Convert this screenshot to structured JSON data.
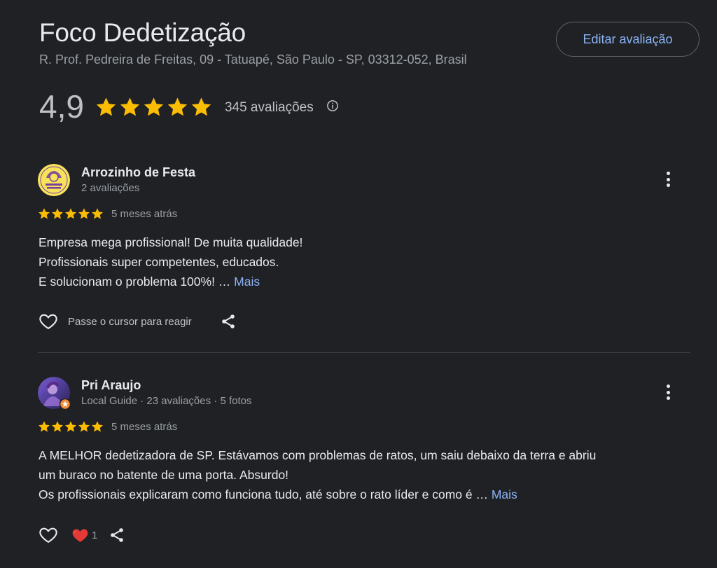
{
  "business": {
    "name": "Foco Dedetização",
    "address": "R. Prof. Pedreira de Freitas, 09 - Tatuapé, São Paulo - SP, 03312-052, Brasil",
    "edit_review_label": "Editar avaliação",
    "rating": "4,9",
    "stars": 5,
    "review_count_label": "345 avaliações"
  },
  "reviews": [
    {
      "author": "Arrozinho de Festa",
      "meta": "2 avaliações",
      "avatar_icon": "arrozinho-logo-avatar",
      "stars": 5,
      "date": "5 meses atrás",
      "text": "Empresa mega profissional! De muita qualidade!\nProfissionais super competentes, educados.\nE solucionam o problema 100%! … ",
      "more_label": "Mais",
      "react_hint": "Passe o cursor para reagir",
      "reaction_count": null
    },
    {
      "author": "Pri Araujo",
      "meta": "Local Guide · 23 avaliações · 5 fotos",
      "avatar_icon": "profile-photo-avatar",
      "stars": 5,
      "date": "5 meses atrás",
      "text": "A MELHOR dedetizadora de SP. Estávamos com problemas de ratos, um saiu debaixo da terra e abriu\num buraco no batente de uma porta. Absurdo!\nOs profissionais explicaram como funciona tudo, até sobre o rato líder e como é … ",
      "more_label": "Mais",
      "react_hint": "",
      "reaction_count": "1"
    }
  ],
  "colors": {
    "background": "#202124",
    "star": "#fbbc04",
    "link": "#8ab4f8",
    "heart_red": "#e53935"
  }
}
